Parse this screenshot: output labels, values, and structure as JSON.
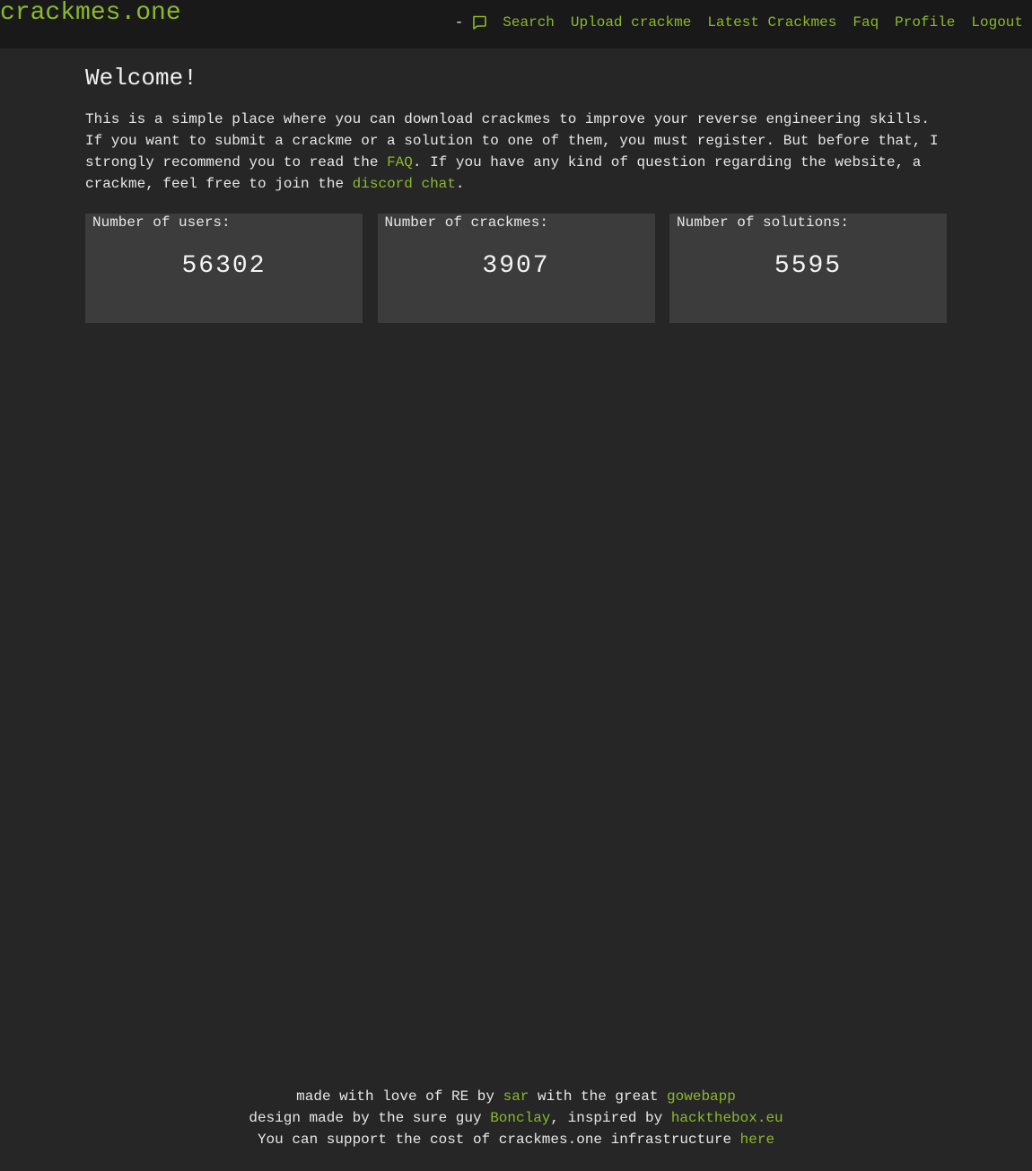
{
  "header": {
    "logo": "crackmes.one",
    "dash": "-",
    "chat_icon": "message-square-icon",
    "nav": {
      "search": "Search",
      "upload": "Upload crackme",
      "latest": "Latest Crackmes",
      "faq": "Faq",
      "profile": "Profile",
      "logout": "Logout"
    }
  },
  "main": {
    "title": "Welcome!",
    "intro": {
      "part1": "This is a simple place where you can download crackmes to improve your reverse engineering skills. If you want to submit a crackme or a solution to one of them, you must register. But before that, I strongly recommend you to read the ",
      "faq_link": "FAQ",
      "part2": ". If you have any kind of question regarding the website, a crackme, feel free to join the ",
      "discord_link": "discord chat",
      "part3": "."
    },
    "stats": [
      {
        "label": "Number of users:",
        "value": "56302"
      },
      {
        "label": "Number of crackmes:",
        "value": "3907"
      },
      {
        "label": "Number of solutions:",
        "value": "5595"
      }
    ]
  },
  "footer": {
    "line1": {
      "a": "made with love of RE by ",
      "sar": "sar",
      "b": " with the great ",
      "gowebapp": "gowebapp"
    },
    "line2": {
      "a": "design made by the sure guy ",
      "bonclay": "Bonclay",
      "b": ", inspired by ",
      "htb": "hackthebox.eu"
    },
    "line3": {
      "a": "You can support the cost of crackmes.one infrastructure ",
      "here": "here"
    }
  },
  "colors": {
    "accent": "#8cb82c",
    "background": "#262626",
    "header_bg": "#191919",
    "card_bg": "#3c3c3c"
  }
}
